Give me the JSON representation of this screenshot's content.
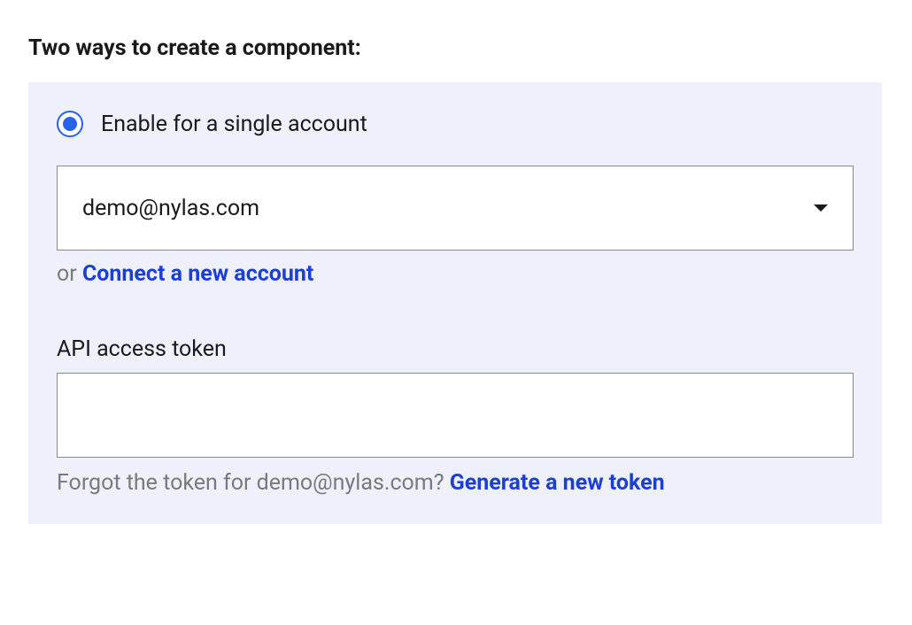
{
  "title": "Two ways to create a component:",
  "option": {
    "radio_selected": true,
    "label": "Enable for a single account"
  },
  "account_select": {
    "value": "demo@nylas.com"
  },
  "connect": {
    "prefix": "or ",
    "link": "Connect a new account"
  },
  "token_field": {
    "label": "API access token",
    "value": ""
  },
  "forgot": {
    "prefix": "Forgot the token for demo@nylas.com? ",
    "link": "Generate a new token"
  }
}
